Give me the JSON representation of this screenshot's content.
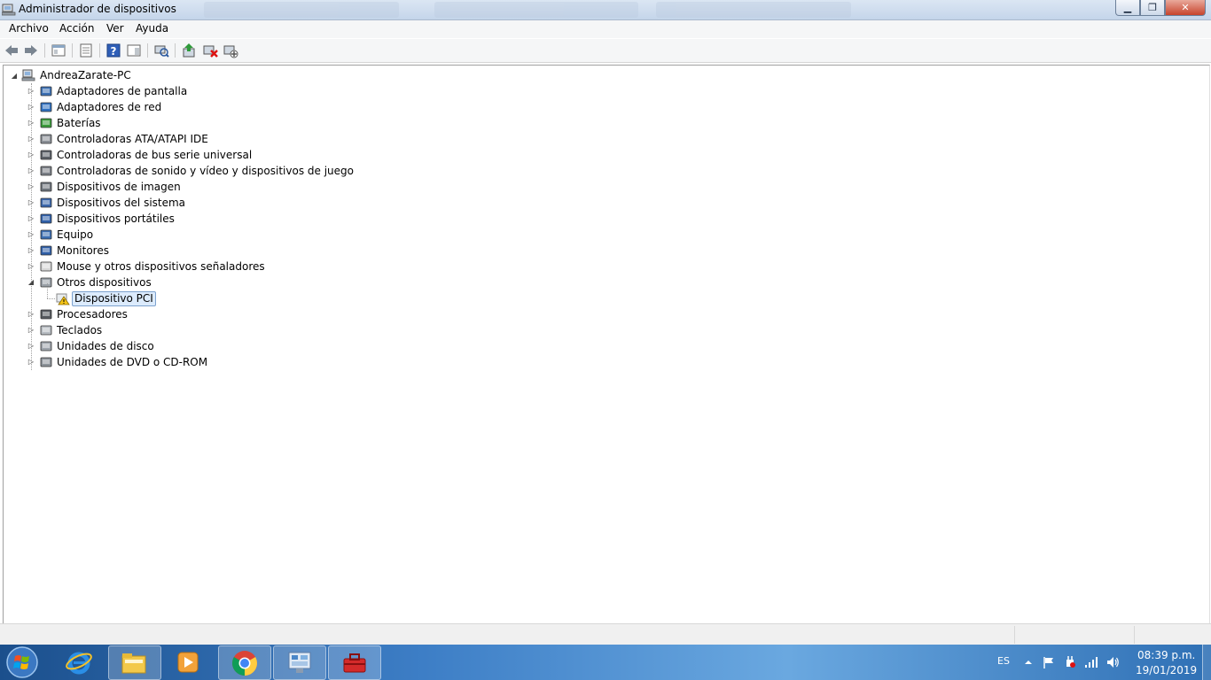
{
  "window": {
    "title": "Administrador de dispositivos",
    "minimize": "▁",
    "maximize": "❐",
    "close": "✕"
  },
  "menu": [
    "Archivo",
    "Acción",
    "Ver",
    "Ayuda"
  ],
  "toolbar": {
    "buttons": [
      "back-icon",
      "forward-icon",
      "console-tree-icon",
      "properties-icon",
      "help-icon",
      "action-pane-icon",
      "scan-hardware-icon",
      "update-driver-icon",
      "uninstall-icon",
      "disable-icon"
    ]
  },
  "tree": {
    "root": "AndreaZarate-PC",
    "categories": [
      {
        "label": "Adaptadores de pantalla",
        "icon": "display-adapter-icon",
        "expanded": false
      },
      {
        "label": "Adaptadores de red",
        "icon": "network-adapter-icon",
        "expanded": false
      },
      {
        "label": "Baterías",
        "icon": "battery-icon",
        "expanded": false
      },
      {
        "label": "Controladoras ATA/ATAPI IDE",
        "icon": "ide-controller-icon",
        "expanded": false
      },
      {
        "label": "Controladoras de bus serie universal",
        "icon": "usb-icon",
        "expanded": false
      },
      {
        "label": "Controladoras de sonido y vídeo y dispositivos de juego",
        "icon": "sound-icon",
        "expanded": false
      },
      {
        "label": "Dispositivos de imagen",
        "icon": "camera-icon",
        "expanded": false
      },
      {
        "label": "Dispositivos del sistema",
        "icon": "system-device-icon",
        "expanded": false
      },
      {
        "label": "Dispositivos portátiles",
        "icon": "portable-device-icon",
        "expanded": false
      },
      {
        "label": "Equipo",
        "icon": "computer-icon",
        "expanded": false
      },
      {
        "label": "Monitores",
        "icon": "monitor-icon",
        "expanded": false
      },
      {
        "label": "Mouse y otros dispositivos señaladores",
        "icon": "mouse-icon",
        "expanded": false
      },
      {
        "label": "Otros dispositivos",
        "icon": "other-devices-icon",
        "expanded": true,
        "children": [
          {
            "label": "Dispositivo PCI",
            "icon": "warning-device-icon",
            "selected": true
          }
        ]
      },
      {
        "label": "Procesadores",
        "icon": "processor-icon",
        "expanded": false
      },
      {
        "label": "Teclados",
        "icon": "keyboard-icon",
        "expanded": false
      },
      {
        "label": "Unidades de disco",
        "icon": "disk-drive-icon",
        "expanded": false
      },
      {
        "label": "Unidades de DVD o CD-ROM",
        "icon": "dvd-drive-icon",
        "expanded": false
      }
    ]
  },
  "taskbar": {
    "apps": [
      "internet-explorer-icon",
      "file-explorer-icon",
      "media-player-icon",
      "chrome-icon",
      "control-panel-icon",
      "toolbox-icon"
    ],
    "language": "ES",
    "time": "08:39 p.m.",
    "date": "19/01/2019"
  },
  "colors": {
    "selection_bg": "#dcebfc",
    "selection_border": "#7da2ce",
    "taskbar": "#2f70b5"
  }
}
